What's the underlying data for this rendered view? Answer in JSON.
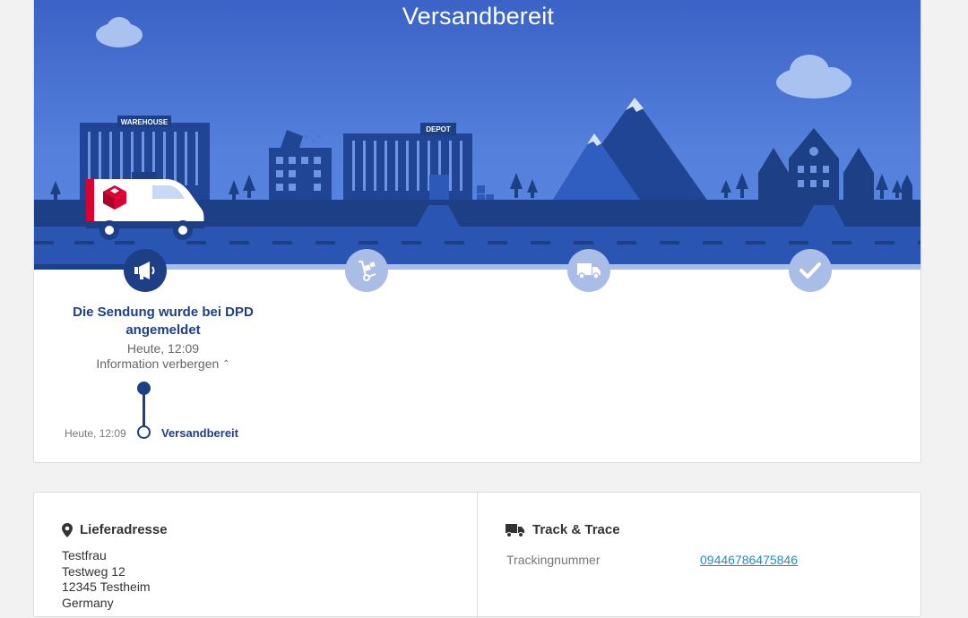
{
  "hero": {
    "title": "Versandbereit",
    "warehouse_sign": "WAREHOUSE",
    "depot_sign": "DEPOT"
  },
  "steps": [
    {
      "name": "announced",
      "icon": "megaphone-icon",
      "state": "active"
    },
    {
      "name": "at-depot",
      "icon": "hand-truck-icon",
      "state": "pending"
    },
    {
      "name": "in-delivery",
      "icon": "delivery-van-icon",
      "state": "pending"
    },
    {
      "name": "delivered",
      "icon": "checkmark-icon",
      "state": "pending"
    }
  ],
  "status": {
    "title": "Die Sendung wurde bei DPD angemeldet",
    "time": "Heute, 12:09",
    "toggle_label": "Information verbergen",
    "toggle_icon": "chevron-up-icon"
  },
  "timeline": [
    {
      "time": "Heute, 12:09",
      "label": "Versandbereit"
    }
  ],
  "delivery_address": {
    "heading": "Lieferadresse",
    "lines": [
      "Testfrau",
      "Testweg 12",
      "12345 Testheim",
      "Germany"
    ]
  },
  "track_trace": {
    "heading": "Track & Trace",
    "label": "Trackingnummer",
    "number": "09446786475846"
  },
  "colors": {
    "sky_top": "#3a63c7",
    "sky_mid": "#5580dc",
    "dark_navy": "#1d3f85",
    "building": "#244a9a",
    "road": "#2a55b3",
    "step_pending": "#aabde6",
    "brand_red": "#dc0032",
    "link": "#1e8fc0"
  }
}
